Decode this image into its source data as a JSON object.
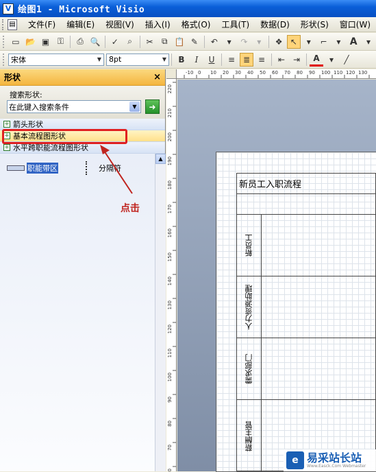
{
  "window": {
    "title": "绘图1 - Microsoft Visio"
  },
  "menu": [
    "文件(F)",
    "编辑(E)",
    "视图(V)",
    "插入(I)",
    "格式(O)",
    "工具(T)",
    "数据(D)",
    "形状(S)",
    "窗口(W)"
  ],
  "format_toolbar": {
    "font": "宋体",
    "size": "8pt",
    "bold": "B",
    "italic": "I",
    "underline": "U",
    "font_color": "A"
  },
  "shapes_panel": {
    "title": "形状",
    "close": "×",
    "search_label": "搜索形状:",
    "search_placeholder": "在此键入搜索条件",
    "stencils": [
      "箭头形状",
      "基本流程图形状",
      "水平跨职能流程图形状"
    ],
    "shapes": [
      "职能带区",
      "分隔符"
    ]
  },
  "annotation": {
    "text": "点击",
    "color": "#c0241f"
  },
  "ruler": {
    "h_ticks": [
      "-10",
      "0",
      "10",
      "20",
      "30",
      "40",
      "50",
      "60",
      "70",
      "80",
      "90",
      "100",
      "110",
      "120",
      "130",
      "140"
    ],
    "v_ticks": [
      "220",
      "210",
      "200",
      "190",
      "180",
      "170",
      "160",
      "150",
      "140",
      "130",
      "120",
      "110",
      "100",
      "90",
      "80",
      "70",
      "60"
    ]
  },
  "diagram": {
    "title": "新员工入职流程",
    "lanes": [
      "新员工",
      "人力资源助理",
      "需求部门",
      "薪酬主管"
    ]
  },
  "watermark": {
    "logo": "e",
    "name": "易采站长站",
    "url": "Www.Easck.Com Webmaster"
  }
}
